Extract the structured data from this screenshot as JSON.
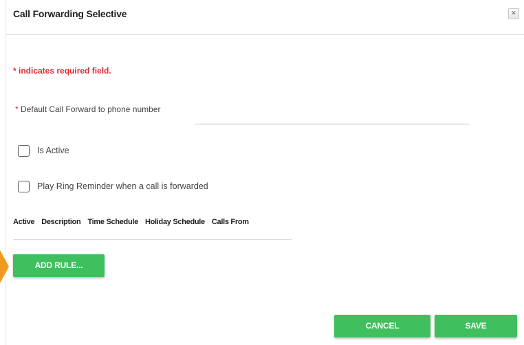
{
  "dialog": {
    "title": "Call Forwarding Selective",
    "close_symbol": "×",
    "close_icon": "close-icon"
  },
  "form": {
    "required_note": "* indicates required field.",
    "phone_label_asterisk": "*",
    "phone_label": "Default Call Forward to phone number",
    "phone_value": "",
    "is_active_label": "Is Active",
    "is_active_checked": false,
    "ring_reminder_label": "Play Ring Reminder when a call is forwarded",
    "ring_reminder_checked": false
  },
  "rules_table": {
    "headers": [
      "Active",
      "Description",
      "Time Schedule",
      "Holiday Schedule",
      "Calls From"
    ],
    "rows": []
  },
  "actions": {
    "add_rule_label": "ADD RULE...",
    "cancel_label": "CANCEL",
    "save_label": "SAVE"
  },
  "colors": {
    "accent_green": "#3fbf5e",
    "required_red": "#e4262f",
    "side_tab_orange": "#f29a1f"
  }
}
